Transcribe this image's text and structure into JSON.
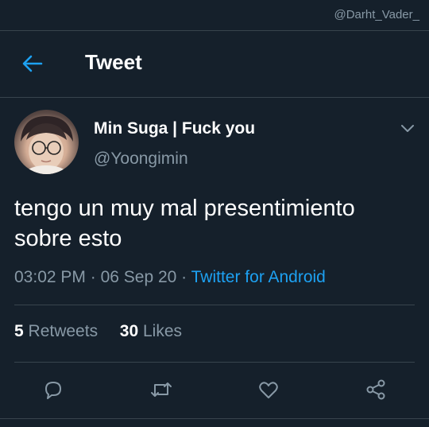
{
  "watermark": "@Darht_Vader_",
  "header": {
    "title": "Tweet"
  },
  "tweet": {
    "display_name": "Min Suga | Fuck you",
    "handle": "@Yoongimin",
    "text_line1": "tengo un muy mal presentimiento",
    "text_line2": "sobre esto",
    "time": "03:02 PM",
    "date": "06 Sep 20",
    "separator": " · ",
    "source": "Twitter for Android"
  },
  "stats": {
    "retweets_count": "5",
    "retweets_label": "Retweets",
    "likes_count": "30",
    "likes_label": "Likes"
  },
  "colors": {
    "background": "#15202b",
    "accent": "#1da1f2",
    "muted": "#8899a6",
    "divider": "#38444d"
  },
  "icons": {
    "back": "arrow-left-icon",
    "more": "chevron-down-icon",
    "reply": "reply-icon",
    "retweet": "retweet-icon",
    "like": "heart-icon",
    "share": "share-icon"
  }
}
